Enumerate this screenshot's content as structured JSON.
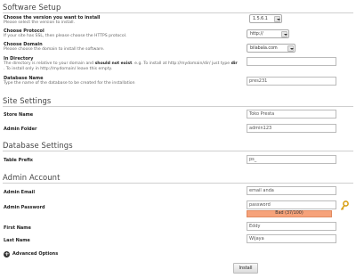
{
  "software_setup": {
    "title": "Software Setup",
    "version": {
      "label": "Choose the version you want to install",
      "desc": "Please select the version to install.",
      "value": "1.5.6.1"
    },
    "protocol": {
      "label": "Choose Protocol",
      "desc": "If your site has SSL, then please choose the HTTPS protocol.",
      "value": "http://"
    },
    "domain": {
      "label": "Choose Domain",
      "desc": "Please choose the domain to install the software.",
      "value": "bilabala.com"
    },
    "directory": {
      "label": "In Directory",
      "desc_1_prefix": "The directory is relative to your domain and ",
      "desc_1_bold": "should not exist",
      "desc_1_suffix": ". e.g. To install at http://mydomain/dir/ just type ",
      "desc_1_bold2": "dir",
      "desc_1_end": ". To install only in http://mydomain/ leave this empty.",
      "value": ""
    },
    "database_name": {
      "label": "Database Name",
      "desc": "Type the name of the database to be created for the installation",
      "value": "pres231"
    }
  },
  "site_settings": {
    "title": "Site Settings",
    "store_name": {
      "label": "Store Name",
      "value": "Toko Presta"
    },
    "admin_folder": {
      "label": "Admin Folder",
      "value": "admin123"
    }
  },
  "database_settings": {
    "title": "Database Settings",
    "table_prefix": {
      "label": "Table Prefix",
      "value": "ps_"
    }
  },
  "admin_account": {
    "title": "Admin Account",
    "admin_email": {
      "label": "Admin Email",
      "value": "email anda"
    },
    "admin_password": {
      "label": "Admin Password",
      "value": "password",
      "strength_text": "Bad (37/100)",
      "strength_color": "#f6a27a"
    },
    "first_name": {
      "label": "First Name",
      "value": "Eddy"
    },
    "last_name": {
      "label": "Last Name",
      "value": "Wijaya"
    }
  },
  "advanced_options": {
    "label": "Advanced Options",
    "icon": "plus-circle-icon"
  },
  "install_button": {
    "label": "Install"
  },
  "icons": {
    "password_generator": "key-icon"
  }
}
